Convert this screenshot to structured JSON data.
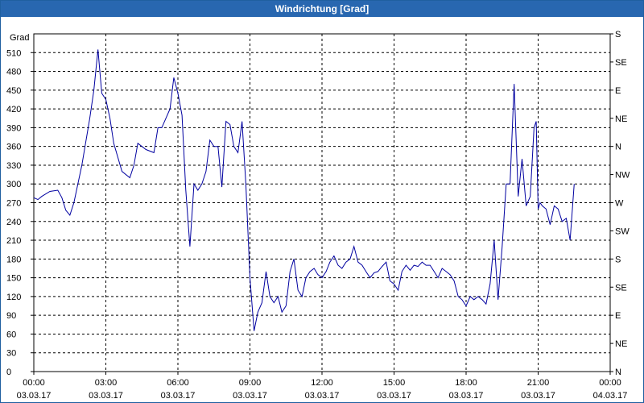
{
  "window": {
    "title": "Windrichtung [Grad]"
  },
  "chart_data": {
    "type": "line",
    "title": "Windrichtung [Grad]",
    "ylabel": "Grad",
    "xlabel": "",
    "ylim": [
      0,
      540
    ],
    "grid": true,
    "line_color": "#0000a0",
    "y_ticks": [
      0,
      30,
      60,
      90,
      120,
      150,
      180,
      210,
      240,
      270,
      300,
      330,
      360,
      390,
      420,
      450,
      480,
      510
    ],
    "y_tick_labels": [
      "0",
      "30",
      "60",
      "90",
      "120",
      "150",
      "180",
      "210",
      "240",
      "270",
      "300",
      "330",
      "360",
      "390",
      "420",
      "450",
      "480",
      "510"
    ],
    "right_ticks": [
      {
        "value": 0,
        "label": "N"
      },
      {
        "value": 45,
        "label": "NE"
      },
      {
        "value": 90,
        "label": "E"
      },
      {
        "value": 135,
        "label": "SE"
      },
      {
        "value": 180,
        "label": "S"
      },
      {
        "value": 225,
        "label": "SW"
      },
      {
        "value": 270,
        "label": "W"
      },
      {
        "value": 315,
        "label": "NW"
      },
      {
        "value": 360,
        "label": "N"
      },
      {
        "value": 405,
        "label": "NE"
      },
      {
        "value": 450,
        "label": "E"
      },
      {
        "value": 495,
        "label": "SE"
      },
      {
        "value": 540,
        "label": "S"
      }
    ],
    "x_range": [
      0,
      24
    ],
    "x_ticks": [
      {
        "value": 0,
        "time": "00:00",
        "date": "03.03.17"
      },
      {
        "value": 3,
        "time": "03:00",
        "date": "03.03.17"
      },
      {
        "value": 6,
        "time": "06:00",
        "date": "03.03.17"
      },
      {
        "value": 9,
        "time": "09:00",
        "date": "03.03.17"
      },
      {
        "value": 12,
        "time": "12:00",
        "date": "03.03.17"
      },
      {
        "value": 15,
        "time": "15:00",
        "date": "03.03.17"
      },
      {
        "value": 18,
        "time": "18:00",
        "date": "03.03.17"
      },
      {
        "value": 21,
        "time": "21:00",
        "date": "03.03.17"
      },
      {
        "value": 24,
        "time": "00:00",
        "date": "04.03.17"
      }
    ],
    "x": [
      0,
      0.17,
      0.33,
      0.67,
      1,
      1.17,
      1.33,
      1.5,
      1.67,
      2,
      2.33,
      2.5,
      2.67,
      2.83,
      3,
      3.17,
      3.33,
      3.67,
      4,
      4.17,
      4.33,
      4.67,
      5,
      5.17,
      5.33,
      5.67,
      5.83,
      6,
      6.17,
      6.33,
      6.5,
      6.67,
      6.83,
      7,
      7.17,
      7.33,
      7.5,
      7.67,
      7.83,
      8,
      8.17,
      8.33,
      8.5,
      8.67,
      8.83,
      9,
      9.17,
      9.33,
      9.5,
      9.67,
      9.83,
      10,
      10.17,
      10.33,
      10.5,
      10.67,
      10.83,
      11,
      11.17,
      11.33,
      11.5,
      11.67,
      11.83,
      12,
      12.17,
      12.33,
      12.5,
      12.67,
      12.83,
      13,
      13.17,
      13.33,
      13.5,
      13.67,
      13.83,
      14,
      14.17,
      14.33,
      14.5,
      14.67,
      14.83,
      15,
      15.17,
      15.33,
      15.5,
      15.67,
      15.83,
      16,
      16.17,
      16.33,
      16.5,
      16.67,
      16.83,
      17,
      17.17,
      17.33,
      17.5,
      17.67,
      17.83,
      18,
      18.17,
      18.33,
      18.5,
      18.67,
      18.83,
      19,
      19.17,
      19.33,
      19.5,
      19.67,
      19.83,
      20,
      20.17,
      20.33,
      20.5,
      20.67,
      20.83,
      20.92,
      21,
      21.08,
      21.17,
      21.33,
      21.5,
      21.67,
      21.83,
      22,
      22.17,
      22.33,
      22.5,
      22.67,
      22.83,
      23,
      23.17,
      23.33,
      23.5,
      23.67,
      23.83,
      24
    ],
    "series": [
      {
        "name": "",
        "values": [
          278,
          275,
          280,
          288,
          290,
          278,
          258,
          250,
          270,
          330,
          405,
          450,
          515,
          445,
          435,
          405,
          365,
          320,
          310,
          330,
          365,
          355,
          350,
          390,
          390,
          420,
          470,
          445,
          410,
          290,
          200,
          300,
          290,
          300,
          320,
          370,
          360,
          360,
          295,
          400,
          395,
          360,
          350,
          400,
          300,
          150,
          65,
          95,
          110,
          160,
          120,
          110,
          120,
          95,
          105,
          160,
          180,
          130,
          120,
          150,
          160,
          165,
          155,
          150,
          160,
          175,
          185,
          170,
          165,
          175,
          180,
          200,
          175,
          170,
          160,
          150,
          158,
          160,
          168,
          175,
          145,
          140,
          130,
          160,
          170,
          162,
          170,
          168,
          175,
          170,
          170,
          160,
          150,
          165,
          160,
          155,
          145,
          120,
          115,
          105,
          120,
          115,
          120,
          115,
          108,
          140,
          210,
          115,
          200,
          300,
          300,
          460,
          280,
          340,
          265,
          280,
          390,
          400,
          260,
          270,
          265,
          260,
          235,
          265,
          260,
          240,
          245,
          210,
          300
        ]
      }
    ]
  }
}
